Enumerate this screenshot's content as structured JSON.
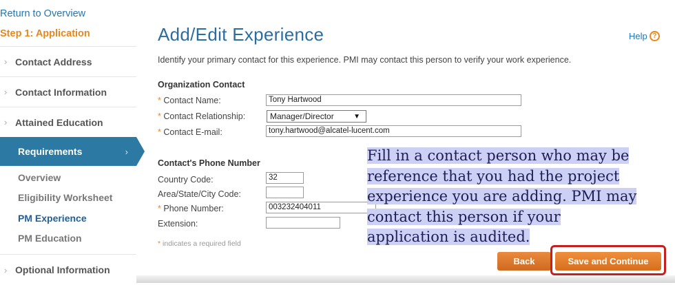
{
  "sidebar": {
    "return_link": "Return to Overview",
    "step_title": "Step 1: Application",
    "items": [
      {
        "label": "Contact Address",
        "chevron": "›"
      },
      {
        "label": "Contact Information",
        "chevron": "›"
      },
      {
        "label": "Attained Education",
        "chevron": "›"
      },
      {
        "label": "Requirements",
        "chevron": "›"
      }
    ],
    "subitems": [
      {
        "label": "Overview"
      },
      {
        "label": "Eligibility Worksheet"
      },
      {
        "label": "PM Experience"
      },
      {
        "label": "PM Education"
      }
    ],
    "optional": {
      "label": "Optional Information",
      "chevron": "›"
    }
  },
  "main": {
    "title": "Add/Edit Experience",
    "help_label": "Help",
    "help_icon": "?",
    "intro": "Identify your primary contact for this experience. PMI may contact this person to verify your work experience.",
    "org_section": {
      "heading": "Organization Contact",
      "name_label": "Contact Name:",
      "name_value": "Tony Hartwood",
      "relationship_label": "Contact Relationship:",
      "relationship_value": "Manager/Director",
      "email_label": "Contact E-mail:",
      "email_value": "tony.hartwood@alcatel-lucent.com"
    },
    "phone_section": {
      "heading": "Contact's Phone Number",
      "country_label": "Country Code:",
      "country_value": "32",
      "area_label": "Area/State/City Code:",
      "area_value": "",
      "phone_label": "Phone Number:",
      "phone_value": "003232404011",
      "ext_label": "Extension:",
      "ext_value": ""
    },
    "required_star": "*",
    "required_note": "indicates a required field"
  },
  "buttons": {
    "back": "Back",
    "save": "Save and Continue"
  },
  "callout": {
    "lines": [
      "Fill in a contact person who may be",
      "reference that you had the project",
      "experience you are adding. PMI may",
      "contact this person if your",
      "application is audited."
    ]
  },
  "colors": {
    "accent_blue": "#2a6d9e",
    "nav_active": "#2c7aa3",
    "orange": "#e8871e",
    "highlight": "#cdd0f5",
    "save_outline": "#c42020"
  }
}
